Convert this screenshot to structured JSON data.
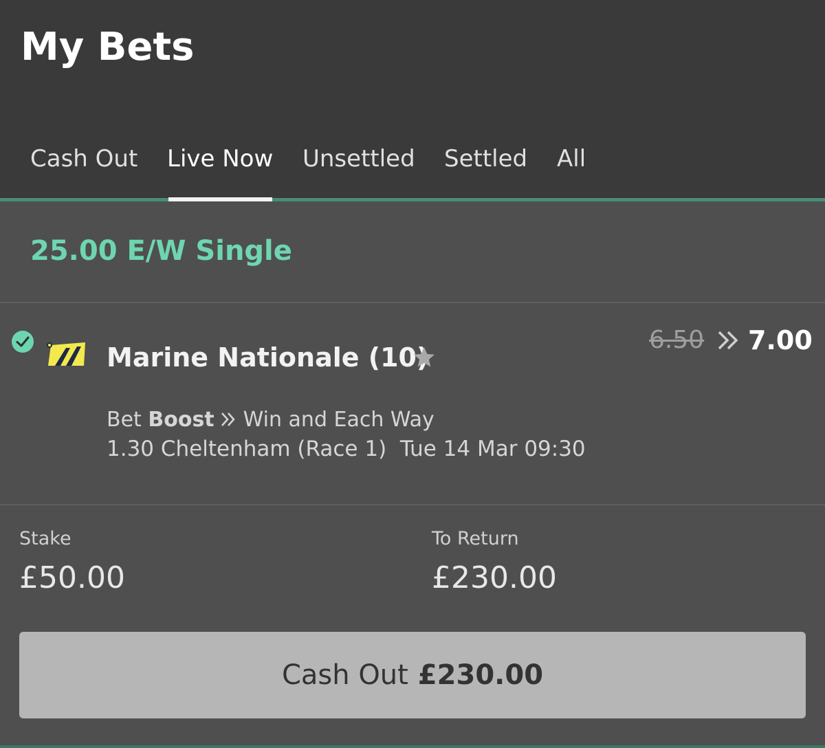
{
  "header": {
    "title": "My Bets"
  },
  "tabs": [
    {
      "label": "Cash Out",
      "active": false
    },
    {
      "label": "Live Now",
      "active": true
    },
    {
      "label": "Unsettled",
      "active": false
    },
    {
      "label": "Settled",
      "active": false
    },
    {
      "label": "All",
      "active": false
    }
  ],
  "bet": {
    "type_label": "25.00 E/W Single",
    "selection": "Marine Nationale (10)",
    "odds_old": "6.50",
    "odds_new": "7.00",
    "boost_prefix": "Bet",
    "boost_bold": "Boost",
    "market": "Win and Each Way",
    "event": "1.30 Cheltenham (Race 1)  Tue 14 Mar 09:30",
    "stake_label": "Stake",
    "stake_value": "£50.00",
    "return_label": "To Return",
    "return_value": "£230.00",
    "cashout_label": "Cash Out",
    "cashout_amount": "£230.00"
  },
  "colors": {
    "accent": "#6dd6b0",
    "header_bg": "#3a3a3a",
    "body_bg": "#4f4f4f",
    "button_bg": "#b6b6b6",
    "silks_yellow": "#f2e94e"
  },
  "icons": {
    "check": "check-circle-icon",
    "silks": "jockey-silks-icon",
    "star": "star-icon",
    "boost_arrow": "double-chevron-right-icon"
  }
}
